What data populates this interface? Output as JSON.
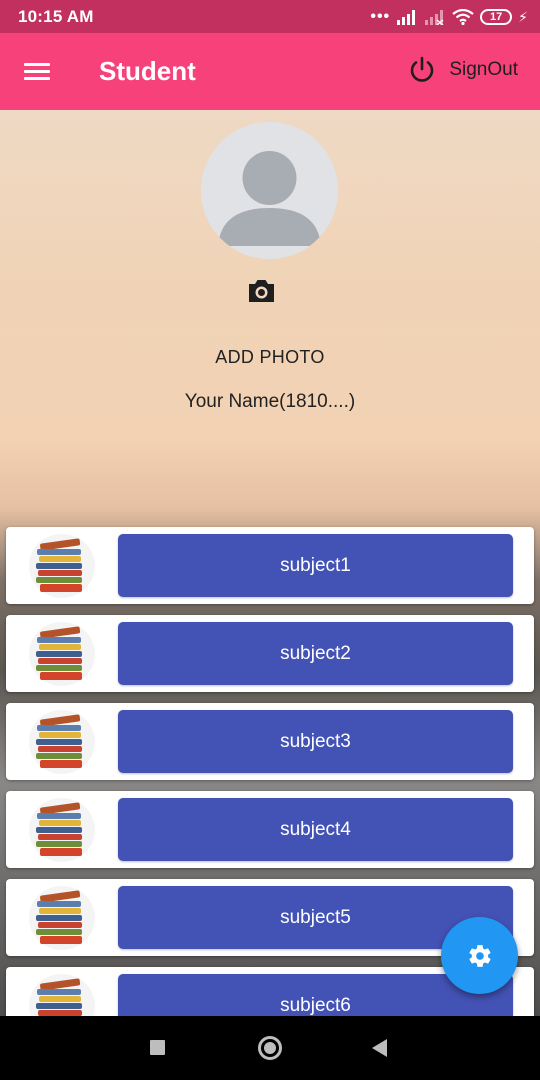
{
  "status_bar": {
    "time": "10:15 AM",
    "signal_dots": "•••",
    "battery": "17",
    "icons": [
      "signal-icon",
      "signal-weak-icon",
      "wifi-icon",
      "battery-icon",
      "charging-icon"
    ]
  },
  "app_bar": {
    "title": "Student",
    "signout_label": "SignOut",
    "menu_icon": "hamburger-menu-icon",
    "power_icon": "power-icon",
    "color": "#f7417b"
  },
  "profile": {
    "add_photo_label": "ADD PHOTO",
    "name": "Your Name(1810....)",
    "camera_icon": "camera-icon"
  },
  "subjects": [
    {
      "label": "subject1"
    },
    {
      "label": "subject2"
    },
    {
      "label": "subject3"
    },
    {
      "label": "subject4"
    },
    {
      "label": "subject5"
    },
    {
      "label": "subject6"
    }
  ],
  "colors": {
    "status_bar": "#c2305f",
    "accent_button": "#4352b5",
    "fab": "#2196f3"
  },
  "fab": {
    "icon": "settings-gear-icon"
  },
  "nav_bar": {
    "icons": [
      "recent-apps-icon",
      "home-icon",
      "back-icon"
    ]
  }
}
